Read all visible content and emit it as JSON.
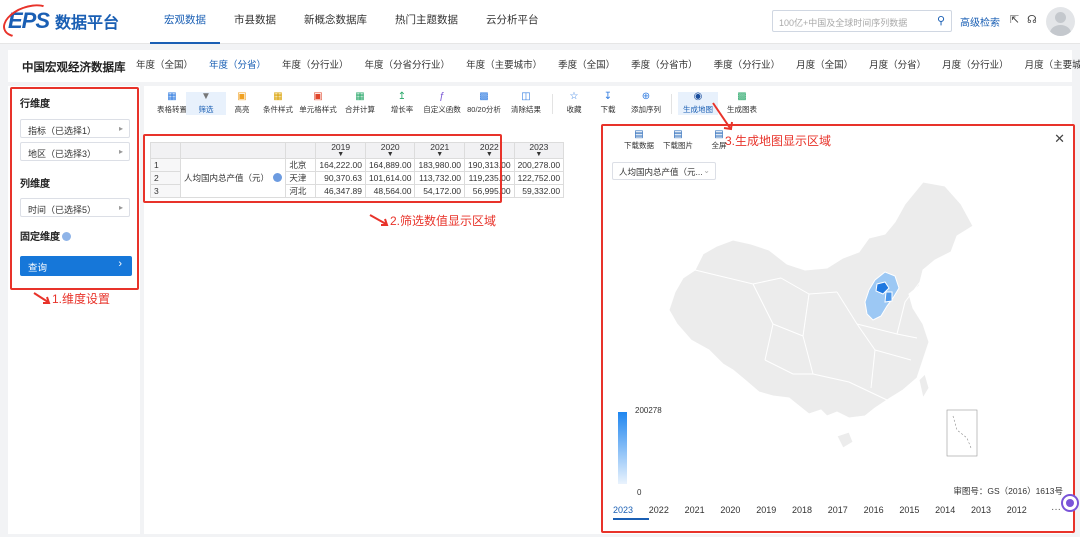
{
  "logo": {
    "brand": "EPS",
    "name": "数据平台"
  },
  "top_menu": [
    "宏观数据",
    "市县数据",
    "新概念数据库",
    "热门主题数据",
    "云分析平台"
  ],
  "search": {
    "placeholder": "100亿+中国及全球时间序列数据",
    "advanced": "高级检索"
  },
  "db_title": "中国宏观经济数据库",
  "sub_tabs": [
    "年度（全国）",
    "年度（分省）",
    "年度（分行业）",
    "年度（分省分行业）",
    "年度（主要城市）",
    "季度（全国）",
    "季度（分省市）",
    "季度（分行业）",
    "月度（全国）",
    "月度（分省）",
    "月度（分行业）",
    "月度（主要城市）"
  ],
  "left": {
    "row_dim": "行维度",
    "row_selects": [
      "指标（已选择1）",
      "地区（已选择3）"
    ],
    "col_dim": "列维度",
    "col_selects": [
      "时间（已选择5）"
    ],
    "fixed_dim": "固定维度",
    "query": "查询"
  },
  "annotations": [
    "1.维度设置",
    "2.筛选数值显示区域",
    "3.生成地图显示区域"
  ],
  "toolbar": [
    "表格转置",
    "筛选",
    "高亮",
    "条件样式",
    "单元格样式",
    "合并计算",
    "增长率",
    "自定义函数",
    "80/20分析",
    "清除结果",
    "收藏",
    "下载",
    "添加序列",
    "生成地图",
    "生成图表"
  ],
  "table": {
    "years": [
      "2019",
      "2020",
      "2021",
      "2022",
      "2023"
    ],
    "indicator": "人均国内总产值（元）",
    "rows": [
      {
        "n": "1",
        "region": "北京",
        "values": [
          "164,222.00",
          "164,889.00",
          "183,980.00",
          "190,313.00",
          "200,278.00"
        ]
      },
      {
        "n": "2",
        "region": "天津",
        "values": [
          "90,370.63",
          "101,614.00",
          "113,732.00",
          "119,235.00",
          "122,752.00"
        ]
      },
      {
        "n": "3",
        "region": "河北",
        "values": [
          "46,347.89",
          "48,564.00",
          "54,172.00",
          "56,995.00",
          "59,332.00"
        ]
      }
    ]
  },
  "map": {
    "tools": [
      "下载数据",
      "下载图片",
      "全屏"
    ],
    "indicator_select": "人均国内总产值（元...",
    "legend_max": "200278",
    "legend_min": "0",
    "approval": "审图号：GS（2016）1613号",
    "years": [
      "2023",
      "2022",
      "2021",
      "2020",
      "2019",
      "2018",
      "2017",
      "2016",
      "2015",
      "2014",
      "2013",
      "2012"
    ],
    "more": "···",
    "colors": {
      "base": "#ececec",
      "beijing": "#1f78e0",
      "tianjin": "#4d97ea",
      "hebei": "#9cc8f4"
    }
  }
}
